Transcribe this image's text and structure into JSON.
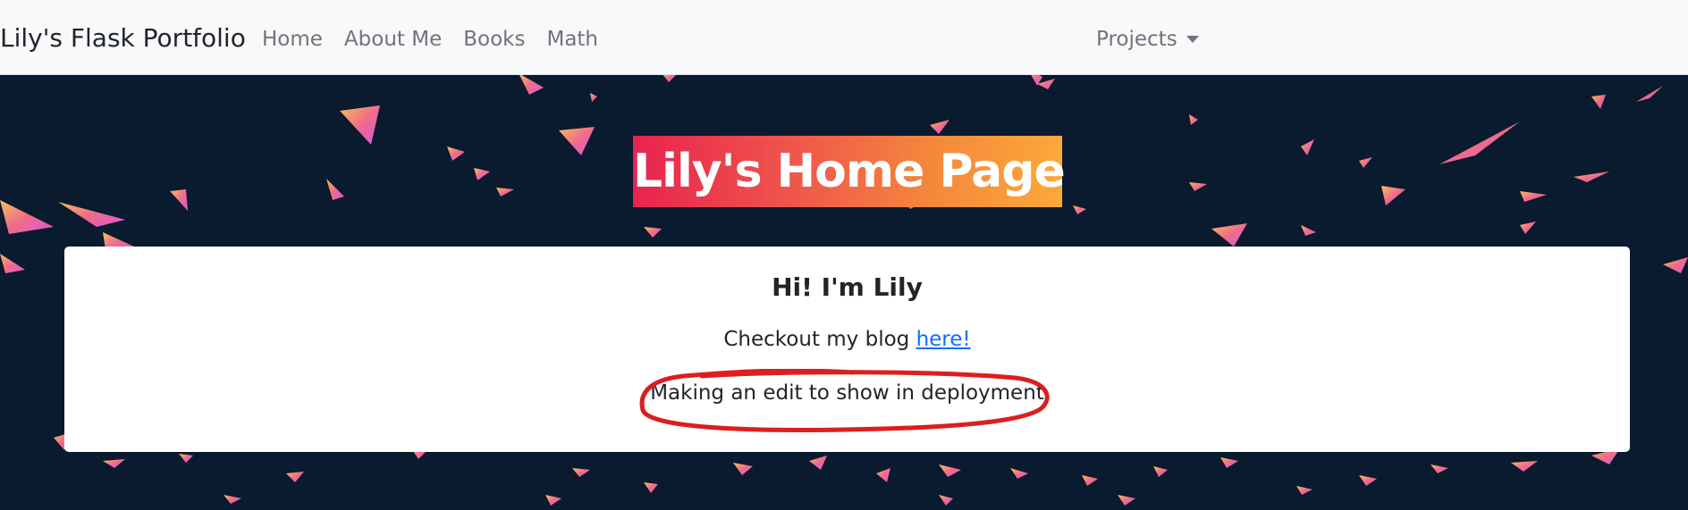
{
  "navbar": {
    "brand": "Lily's Flask Portfolio",
    "links": [
      "Home",
      "About Me",
      "Books",
      "Math"
    ],
    "dropdown_label": "Projects"
  },
  "hero": {
    "title": "Lily's Home Page",
    "title_gradient": [
      "#e8234e",
      "#fba93a"
    ],
    "background_color": "#0a1a2f"
  },
  "card": {
    "heading": "Hi! I'm Lily",
    "blog_prefix": "Checkout my blog ",
    "blog_link_text": "here!",
    "edit_text": "Making an edit to show in deployment",
    "annotation_color": "#dc1e1e"
  }
}
